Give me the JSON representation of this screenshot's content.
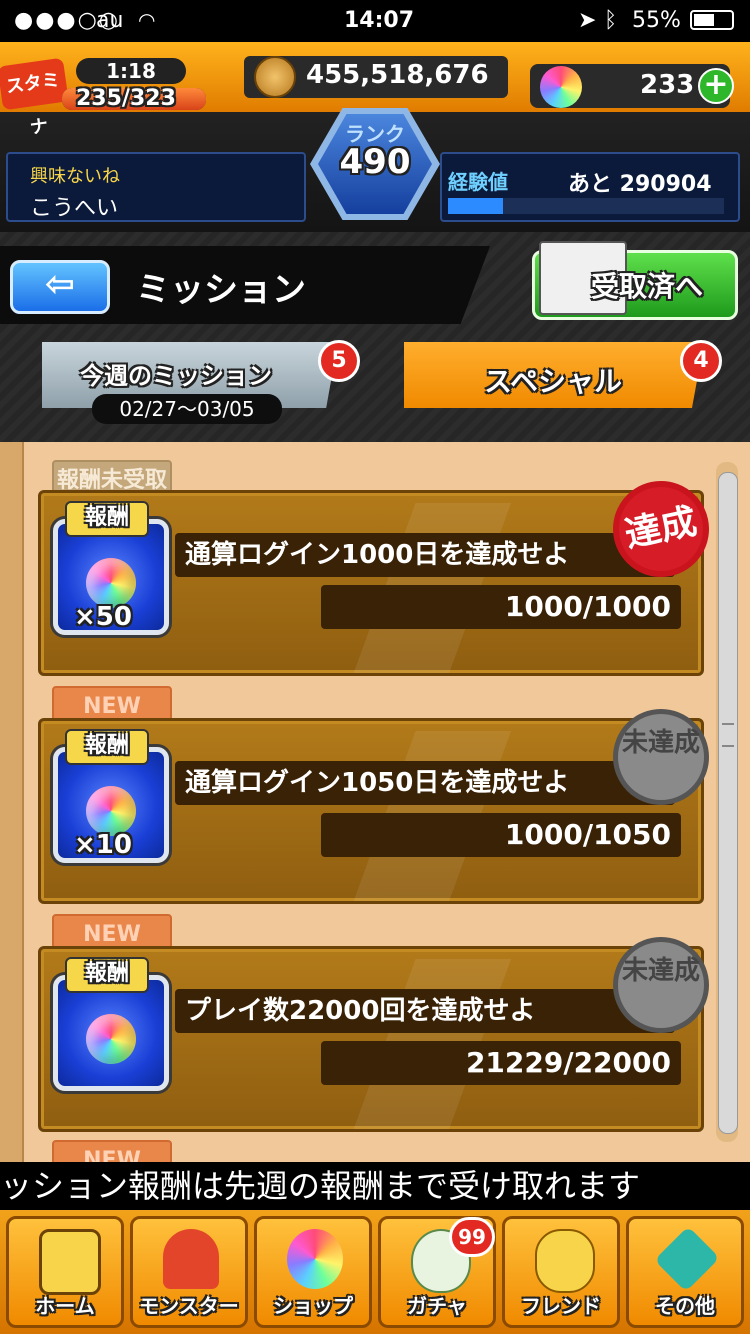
{
  "status_bar": {
    "carrier": "au",
    "time": "14:07",
    "battery": "55%"
  },
  "header": {
    "stamina_label": "スタミナ",
    "stamina_timer": "1:18",
    "stamina_value": "235/323",
    "coins": "455,518,676",
    "orbs": "233",
    "rank_label": "ランク",
    "rank_value": "490",
    "user_status": "興味ないね",
    "user_name": "こうへい",
    "exp_label": "経験値",
    "exp_remaining": "あと 290904",
    "exp_fraction": 0.2
  },
  "titlebar": {
    "title": "ミッション",
    "received_button": "受取済へ",
    "tabs": [
      {
        "label": "今週のミッション",
        "subtitle": "02/27〜03/05",
        "badge": "5"
      },
      {
        "label": "スペシャル",
        "badge": "4"
      }
    ]
  },
  "missions": [
    {
      "tag": "報酬未受取",
      "reward_label": "報酬",
      "reward_qty": "×50",
      "title": "通算ログイン1000日を達成せよ",
      "progress": "1000/1000",
      "stamp": "達成"
    },
    {
      "tag": "NEW",
      "reward_label": "報酬",
      "reward_qty": "×10",
      "title": "通算ログイン1050日を達成せよ",
      "progress": "1000/1050",
      "stamp": "未達成"
    },
    {
      "tag": "NEW",
      "reward_label": "報酬",
      "reward_qty": "",
      "title": "プレイ数22000回を達成せよ",
      "progress": "21229/22000",
      "stamp": "未達成"
    },
    {
      "tag": "NEW"
    }
  ],
  "ticker": "ッション報酬は先週の報酬まで受け取れます",
  "nav": [
    {
      "label": "ホーム"
    },
    {
      "label": "モンスター"
    },
    {
      "label": "ショップ"
    },
    {
      "label": "ガチャ",
      "badge": "99"
    },
    {
      "label": "フレンド"
    },
    {
      "label": "その他"
    }
  ]
}
